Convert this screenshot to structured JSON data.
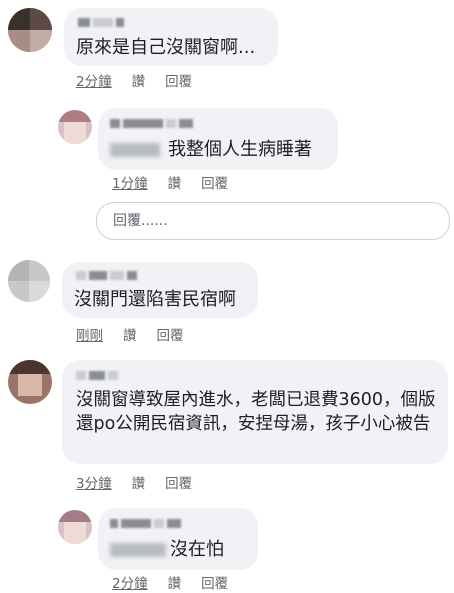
{
  "comments": [
    {
      "text": "原來是自己沒關窗啊...",
      "time": "2分鐘",
      "like": "讚",
      "reply": "回覆"
    },
    {
      "text": "我整個人生病睡著",
      "time": "1分鐘",
      "like": "讚",
      "reply": "回覆"
    },
    {
      "text": "沒關門還陷害民宿啊",
      "time": "剛剛",
      "like": "讚",
      "reply": "回覆"
    },
    {
      "text": "沒關窗導致屋內進水，老闆已退費3600，個版還po公開民宿資訊，安捏母湯，孩子小心被告",
      "time": "3分鐘",
      "like": "讚",
      "reply": "回覆"
    },
    {
      "text": "沒在怕",
      "time": "2分鐘",
      "like": "讚",
      "reply": "回覆"
    }
  ],
  "reply_input": {
    "placeholder": "回覆......"
  },
  "icons": {
    "avatar": "avatar-image"
  },
  "colors": {
    "bubble": "#f0f2f5",
    "meta_text": "#65676b",
    "body_text": "#1c1e21"
  }
}
